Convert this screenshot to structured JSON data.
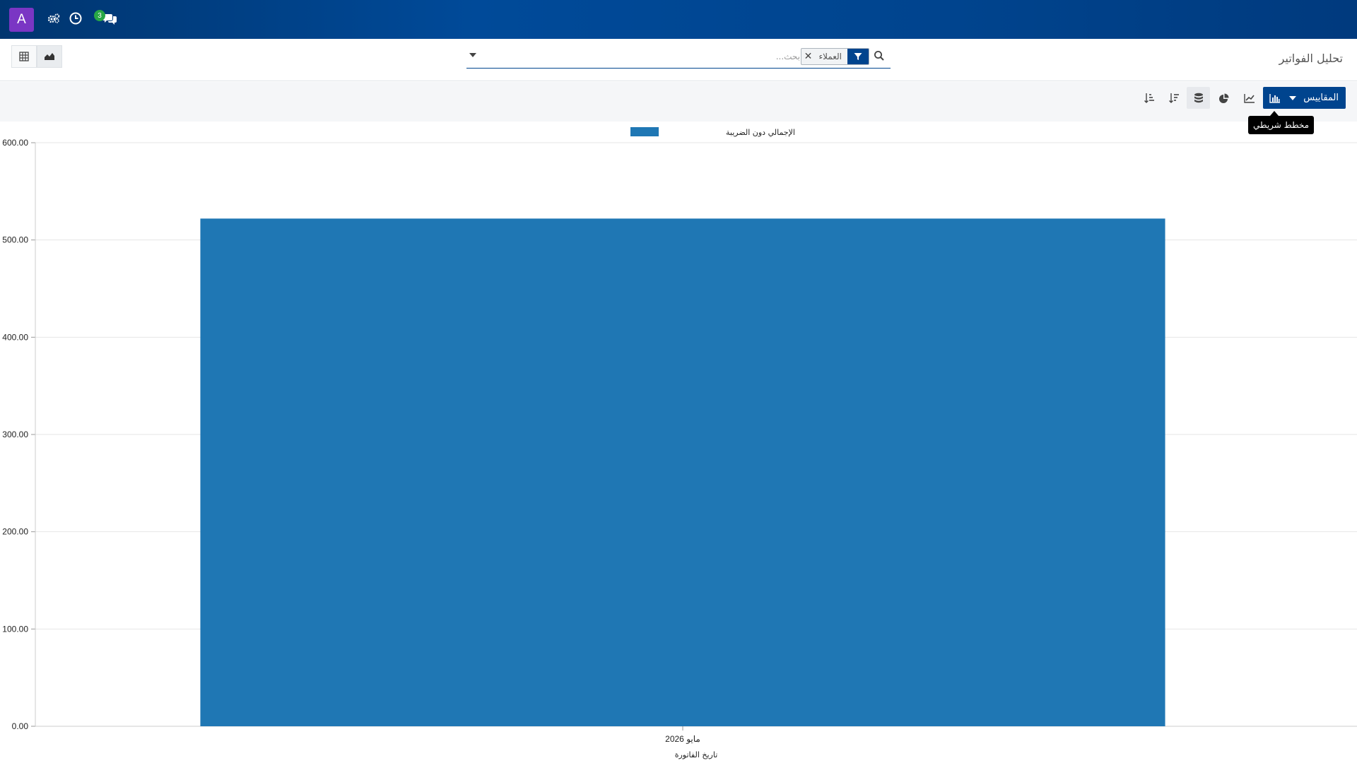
{
  "navbar": {
    "avatar_letter": "A",
    "messages_count": "3"
  },
  "control_panel": {
    "page_title": "تحليل الفواتير",
    "search": {
      "facet_value": "العملاء",
      "placeholder": "بحث..."
    }
  },
  "toolbar": {
    "measures_label": "المقاييس",
    "tooltip": "مخطط شريطي"
  },
  "colors": {
    "navbar": "#00448e",
    "accent": "#00448e",
    "bar": "#1f77b4",
    "avatar": "#7a36c4",
    "badge": "#28a745"
  },
  "chart_data": {
    "type": "bar",
    "categories": [
      "مايو 2026"
    ],
    "series": [
      {
        "name": "الإجمالي دون الضريبة",
        "values": [
          522
        ]
      }
    ],
    "xlabel": "تاريخ الفاتورة",
    "ylabel": "",
    "ylim": [
      0,
      600
    ],
    "yticks": [
      "0.00",
      "100.00",
      "200.00",
      "300.00",
      "400.00",
      "500.00",
      "600.00"
    ],
    "grid": true,
    "legend_position": "top-center"
  }
}
